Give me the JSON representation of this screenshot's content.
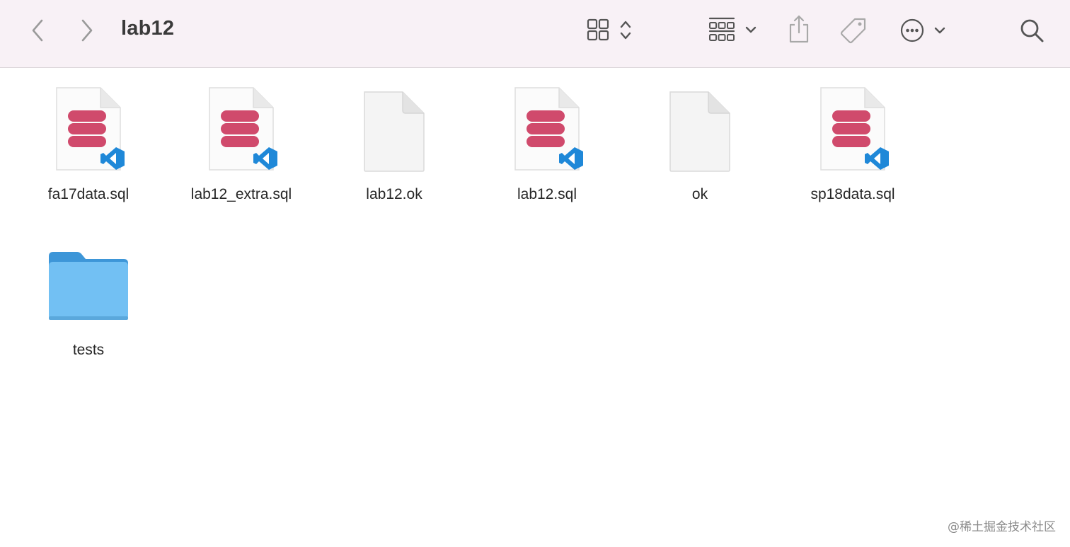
{
  "window": {
    "title": "lab12"
  },
  "toolbar": {
    "back_icon": "chevron-left-icon",
    "forward_icon": "chevron-right-icon",
    "view_icon": "grid-view-icon",
    "group_icon": "group-by-icon",
    "share_icon": "share-icon",
    "tag_icon": "tag-icon",
    "more_icon": "ellipsis-circle-icon",
    "search_icon": "search-icon"
  },
  "files": [
    {
      "name": "fa17data.sql",
      "kind": "sql"
    },
    {
      "name": "lab12_extra.sql",
      "kind": "sql"
    },
    {
      "name": "lab12.ok",
      "kind": "blank"
    },
    {
      "name": "lab12.sql",
      "kind": "sql"
    },
    {
      "name": "ok",
      "kind": "blank"
    },
    {
      "name": "sp18data.sql",
      "kind": "sql"
    },
    {
      "name": "tests",
      "kind": "folder"
    }
  ],
  "colors": {
    "toolbar_bg": "#f8f1f6",
    "db_red": "#d04a6c",
    "vscode_blue": "#1f88d8",
    "folder_blue": "#72c0f3"
  },
  "watermark": "@稀土掘金技术社区"
}
